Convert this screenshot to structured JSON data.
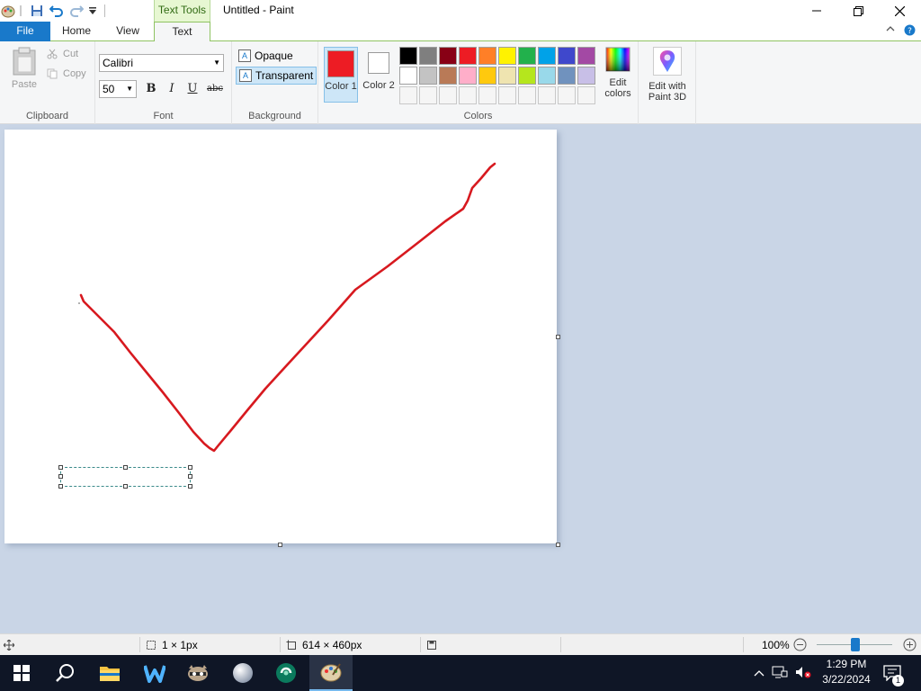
{
  "window": {
    "title": "Untitled - Paint",
    "contextual_tab": "Text Tools",
    "controls": {
      "minimize": "minimize-icon",
      "maximize": "restore-icon",
      "close": "close-icon"
    }
  },
  "quick_access": [
    "app-menu-icon",
    "save-icon",
    "undo-icon",
    "redo-icon",
    "customize-icon"
  ],
  "tabs": [
    {
      "label": "File"
    },
    {
      "label": "Home"
    },
    {
      "label": "View"
    },
    {
      "label": "Text"
    }
  ],
  "clipboard": {
    "paste": "Paste",
    "cut": "Cut",
    "copy": "Copy",
    "group": "Clipboard"
  },
  "font": {
    "family": "Calibri",
    "size": "50",
    "bold": "B",
    "italic": "I",
    "underline": "U",
    "strike": "abc",
    "group": "Font"
  },
  "background": {
    "opaque": "Opaque",
    "transparent": "Transparent",
    "selected": "transparent",
    "group": "Background"
  },
  "colors": {
    "color1_label": "Color 1",
    "color1": "#ed1c24",
    "color2_label": "Color 2",
    "color2": "#ffffff",
    "palette": [
      "#000000",
      "#7f7f7f",
      "#880015",
      "#ed1c24",
      "#ff7f27",
      "#fff200",
      "#22b14c",
      "#00a2e8",
      "#3f48cc",
      "#a349a4",
      "#ffffff",
      "#c3c3c3",
      "#b97a57",
      "#ffaec9",
      "#ffc90e",
      "#efe4b0",
      "#b5e61d",
      "#99d9ea",
      "#7092be",
      "#c8bfe7",
      "#f5f5f5",
      "#f5f5f5",
      "#f5f5f5",
      "#f5f5f5",
      "#f5f5f5",
      "#f5f5f5",
      "#f5f5f5",
      "#f5f5f5",
      "#f5f5f5",
      "#f5f5f5"
    ],
    "edit": "Edit colors",
    "group": "Colors"
  },
  "paint3d": {
    "label": "Edit with Paint 3D"
  },
  "canvas": {
    "stroke_color": "#d7191f"
  },
  "status": {
    "selection": "1 × 1px",
    "canvas_size": "614 × 460px",
    "zoom": "100%"
  },
  "taskbar": {
    "apps": [
      "start-icon",
      "search-icon",
      "file-explorer-icon",
      "app-w-icon",
      "app-raccoon-icon",
      "app-ball-icon",
      "app-green-icon",
      "paint-icon"
    ],
    "time": "1:29 PM",
    "date": "3/22/2024",
    "notification_count": "1"
  }
}
